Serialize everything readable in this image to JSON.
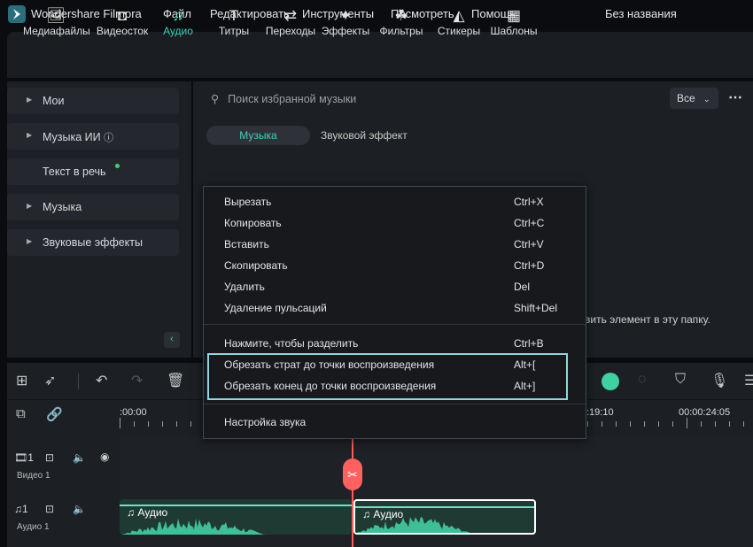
{
  "app": {
    "title": "Wondershare Filmora",
    "project": "Без названия"
  },
  "menu": [
    "Файл",
    "Редактировать",
    "Инструменты",
    "Посмотреть",
    "Помощь"
  ],
  "toolbar": [
    {
      "label": "Медиафайлы",
      "icon": "media-icon"
    },
    {
      "label": "Видеосток",
      "icon": "stock-icon"
    },
    {
      "label": "Аудио",
      "icon": "music-note-icon",
      "active": true
    },
    {
      "label": "Титры",
      "icon": "text-icon"
    },
    {
      "label": "Переходы",
      "icon": "transition-icon"
    },
    {
      "label": "Эффекты",
      "icon": "effects-icon"
    },
    {
      "label": "Фильтры",
      "icon": "filters-icon"
    },
    {
      "label": "Стикеры",
      "icon": "stickers-icon"
    },
    {
      "label": "Шаблоны",
      "icon": "templates-icon"
    }
  ],
  "sidebar": {
    "items": [
      {
        "label": "Мои"
      },
      {
        "label": "Музыка ИИ"
      },
      {
        "label": "Текст в речь"
      },
      {
        "label": "Музыка"
      },
      {
        "label": "Звуковые эффекты"
      }
    ]
  },
  "search": {
    "placeholder": "Поиск избранной музыки",
    "filter": "Все"
  },
  "tabs": [
    "Музыка",
    "Звуковой эффект"
  ],
  "hint": "вить элемент в эту папку.",
  "context_menu": [
    {
      "label": "Вырезать",
      "shortcut": "Ctrl+X"
    },
    {
      "label": "Копировать",
      "shortcut": "Ctrl+C"
    },
    {
      "label": "Вставить",
      "shortcut": "Ctrl+V"
    },
    {
      "label": "Скопировать",
      "shortcut": "Ctrl+D"
    },
    {
      "label": "Удалить",
      "shortcut": "Del"
    },
    {
      "label": "Удаление пульсаций",
      "shortcut": "Shift+Del"
    },
    {
      "label": "Нажмите, чтобы разделить",
      "shortcut": "Ctrl+B"
    },
    {
      "label": "Обрезать страт до точки воспроизведения",
      "shortcut": "Alt+["
    },
    {
      "label": "Обрезать конец до точки воспроизведения",
      "shortcut": "Alt+]"
    },
    {
      "label": "Настройка звука",
      "shortcut": ""
    }
  ],
  "timeline": {
    "ruler": [
      ":00:00",
      ":19:10",
      "00:00:24:05"
    ],
    "tracks": [
      {
        "num": "1",
        "name": "Видео 1"
      },
      {
        "num": "1",
        "name": "Аудио 1"
      }
    ],
    "clips": [
      "Аудио",
      "Аудио"
    ]
  },
  "colors": {
    "accent": "#3fd1b6",
    "playhead": "#ff5b5b",
    "highlight": "#8ed6e0"
  }
}
